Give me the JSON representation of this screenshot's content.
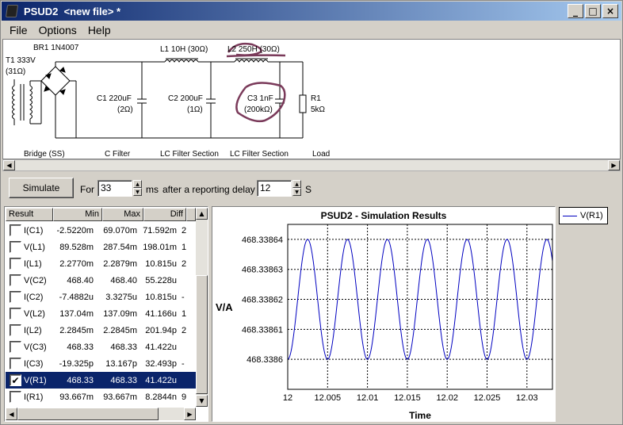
{
  "window": {
    "title": "PSUD2  <new file> *",
    "minimize_label": "_",
    "maximize_label": "□",
    "close_label": "×"
  },
  "menu": {
    "items": [
      "File",
      "Options",
      "Help"
    ]
  },
  "circuit": {
    "transformer_name": "T1 333V",
    "transformer_res": "(31Ω)",
    "rectifier": "BR1 1N4007",
    "l1": "L1 10H (30Ω)",
    "l2": "L2 250H (30Ω)",
    "c1_name": "C1 220uF",
    "c1_res": "(2Ω)",
    "c2_name": "C2 200uF",
    "c2_res": "(1Ω)",
    "c3_name": "C3 1nF",
    "c3_res": "(200kΩ)",
    "r1_name": "R1",
    "r1_val": "5kΩ",
    "sections": [
      "Bridge (SS)",
      "C Filter",
      "LC Filter Section",
      "LC Filter Section",
      "Load"
    ],
    "annotation_color": "#7a3a5a"
  },
  "controls": {
    "simulate_label": "Simulate",
    "for_label": "For",
    "duration_value": "33",
    "ms_label": "ms",
    "delay_label": "after a reporting delay of",
    "delay_value": "12",
    "s_label": "S"
  },
  "results": {
    "headers": [
      "Result",
      "Min",
      "Max",
      "Diff"
    ],
    "rows": [
      {
        "name": "I(C1)",
        "min": "-2.5220m",
        "max": "69.070m",
        "diff": "71.592m",
        "extra": "2",
        "checked": false,
        "selected": false
      },
      {
        "name": "V(L1)",
        "min": "89.528m",
        "max": "287.54m",
        "diff": "198.01m",
        "extra": "1",
        "checked": false,
        "selected": false
      },
      {
        "name": "I(L1)",
        "min": "2.2770m",
        "max": "2.2879m",
        "diff": "10.815u",
        "extra": "2",
        "checked": false,
        "selected": false
      },
      {
        "name": "V(C2)",
        "min": "468.40",
        "max": "468.40",
        "diff": "55.228u",
        "extra": "",
        "checked": false,
        "selected": false
      },
      {
        "name": "I(C2)",
        "min": "-7.4882u",
        "max": "3.3275u",
        "diff": "10.815u",
        "extra": "-",
        "checked": false,
        "selected": false
      },
      {
        "name": "V(L2)",
        "min": "137.04m",
        "max": "137.09m",
        "diff": "41.166u",
        "extra": "1",
        "checked": false,
        "selected": false
      },
      {
        "name": "I(L2)",
        "min": "2.2845m",
        "max": "2.2845m",
        "diff": "201.94p",
        "extra": "2",
        "checked": false,
        "selected": false
      },
      {
        "name": "V(C3)",
        "min": "468.33",
        "max": "468.33",
        "diff": "41.422u",
        "extra": "",
        "checked": false,
        "selected": false
      },
      {
        "name": "I(C3)",
        "min": "-19.325p",
        "max": "13.167p",
        "diff": "32.493p",
        "extra": "-",
        "checked": false,
        "selected": false
      },
      {
        "name": "V(R1)",
        "min": "468.33",
        "max": "468.33",
        "diff": "41.422u",
        "extra": "",
        "checked": true,
        "selected": true
      },
      {
        "name": "I(R1)",
        "min": "93.667m",
        "max": "93.667m",
        "diff": "8.2844n",
        "extra": "9",
        "checked": false,
        "selected": false
      }
    ]
  },
  "chart_data": {
    "type": "line",
    "title": "PSUD2 - Simulation Results",
    "xlabel": "Time",
    "ylabel": "V/A",
    "xlim": [
      12.0,
      12.0332
    ],
    "ylim": [
      468.33859,
      468.338645
    ],
    "x_ticks": [
      12,
      12.005,
      12.01,
      12.015,
      12.02,
      12.025,
      12.03
    ],
    "x_tick_labels": [
      "12",
      "12.005",
      "12.01",
      "12.015",
      "12.02",
      "12.025",
      "12.03"
    ],
    "y_ticks": [
      468.3386,
      468.33861,
      468.33862,
      468.33863,
      468.33864
    ],
    "y_tick_labels": [
      "468.3386",
      "468.33861",
      "468.33862",
      "468.33863",
      "468.33864"
    ],
    "grid": true,
    "legend": "outside-right",
    "series": [
      {
        "name": "V(R1)",
        "color": "#0000c0",
        "period": 0.005,
        "peak_x": 12.0025,
        "min": 468.3386,
        "max": 468.33864
      }
    ]
  }
}
